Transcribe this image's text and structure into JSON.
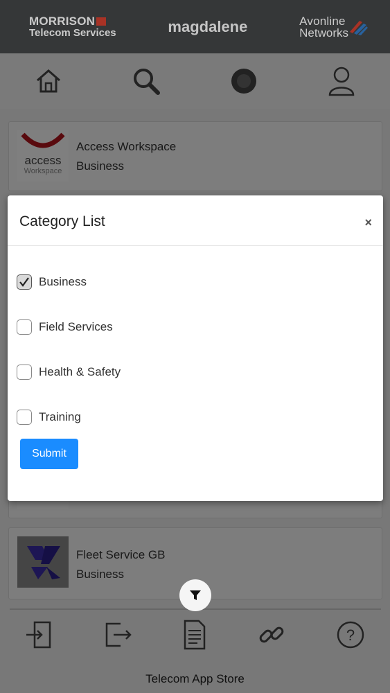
{
  "header": {
    "brand_left_line1": "MORRISON",
    "brand_left_line2": "Telecom Services",
    "brand_center": "magdalene",
    "brand_right_line1": "Avonline",
    "brand_right_line2": "Networks"
  },
  "topnav": {
    "icons": [
      "home-icon",
      "search-icon",
      "badge-icon",
      "profile-icon"
    ]
  },
  "apps": [
    {
      "name": "Access Workspace",
      "category": "Business",
      "logo_text": "access",
      "logo_subtext": "Workspace"
    },
    {
      "name": "Fleet Service GB",
      "category": "Business"
    }
  ],
  "modal": {
    "title": "Category List",
    "close_label": "×",
    "options": [
      {
        "label": "Business",
        "checked": true
      },
      {
        "label": "Field Services",
        "checked": false
      },
      {
        "label": "Health & Safety",
        "checked": false
      },
      {
        "label": "Training",
        "checked": false
      }
    ],
    "submit_label": "Submit"
  },
  "bottomnav": {
    "icons": [
      "login-icon",
      "logout-icon",
      "document-icon",
      "link-icon",
      "help-icon"
    ]
  },
  "footer": {
    "text": "Telecom App Store"
  },
  "colors": {
    "header_bg": "#3d3f40",
    "submit_bg": "#1a8cff",
    "accent_red": "#c0392b"
  }
}
